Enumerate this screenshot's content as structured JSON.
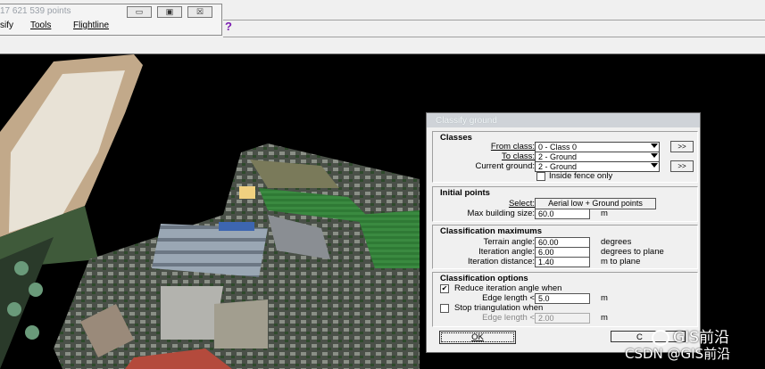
{
  "mini_window": {
    "title": "17 621 539 points",
    "menu": [
      "sify",
      "Tools",
      "Flightline"
    ]
  },
  "toolbar": {
    "help": "?"
  },
  "dialog": {
    "title": "Classify ground",
    "classes": {
      "header": "Classes",
      "from_label": "From class:",
      "from_value": "0 - Class 0",
      "to_label": "To class:",
      "to_value": "2 - Ground",
      "current_label": "Current ground:",
      "current_value": "2 - Ground",
      "more": ">>",
      "inside_fence": "Inside fence only"
    },
    "initial": {
      "header": "Initial points",
      "select_label": "Select:",
      "select_value": "Aerial low + Ground points",
      "maxbld_label": "Max building size:",
      "maxbld_value": "60.0",
      "maxbld_unit": "m"
    },
    "maximums": {
      "header": "Classification maximums",
      "terrain_label": "Terrain angle:",
      "terrain_value": "60.00",
      "terrain_unit": "degrees",
      "iter_label": "Iteration angle:",
      "iter_value": "6.00",
      "iter_unit": "degrees to plane",
      "dist_label": "Iteration distance:",
      "dist_value": "1.40",
      "dist_unit": "m to plane"
    },
    "options": {
      "header": "Classification options",
      "reduce_label": "Reduce iteration angle when",
      "edge1_label": "Edge length <",
      "edge1_value": "5.0",
      "edge1_unit": "m",
      "stop_label": "Stop triangulation when",
      "edge2_label": "Edge length <",
      "edge2_value": "2.00",
      "edge2_unit": "m"
    },
    "ok": "OK",
    "cancel_partial": "C"
  },
  "watermark": {
    "line1": "GIS前沿",
    "line2": "CSDN @GIS前沿"
  }
}
